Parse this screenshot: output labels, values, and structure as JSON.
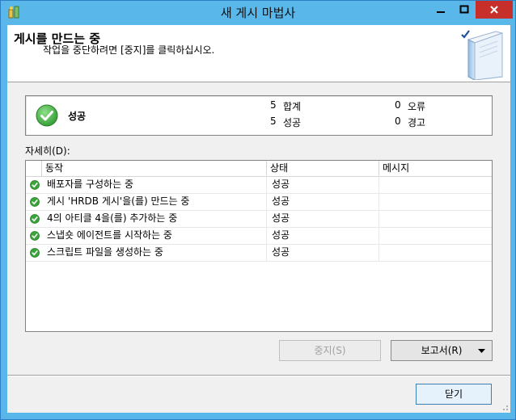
{
  "window": {
    "title": "새 게시 마법사"
  },
  "header": {
    "title": "게시를 만드는 중",
    "subtitle": "작업을 중단하려면 [중지]를 클릭하십시오."
  },
  "summary": {
    "status": "성공",
    "total_count": "5",
    "total_label": "합계",
    "success_count": "5",
    "success_label": "성공",
    "error_count": "0",
    "error_label": "오류",
    "warning_count": "0",
    "warning_label": "경고"
  },
  "details": {
    "label": "자세히(D):",
    "columns": [
      "동작",
      "상태",
      "메시지"
    ],
    "rows": [
      {
        "action": "배포자를 구성하는 중",
        "status": "성공",
        "message": ""
      },
      {
        "action": "게시 'HRDB 게시'을(를) 만드는 중",
        "status": "성공",
        "message": ""
      },
      {
        "action": "4의 아티클 4을(를) 추가하는 중",
        "status": "성공",
        "message": ""
      },
      {
        "action": "스냅숏 에이전트를 시작하는 중",
        "status": "성공",
        "message": ""
      },
      {
        "action": "스크립트 파일을 생성하는 중",
        "status": "성공",
        "message": ""
      }
    ]
  },
  "buttons": {
    "stop": "중지(S)",
    "report": "보고서(R)",
    "close": "닫기"
  },
  "colors": {
    "titlebar": "#5ab7ea",
    "close_button": "#c7302a",
    "success_green": "#3aa43a"
  }
}
